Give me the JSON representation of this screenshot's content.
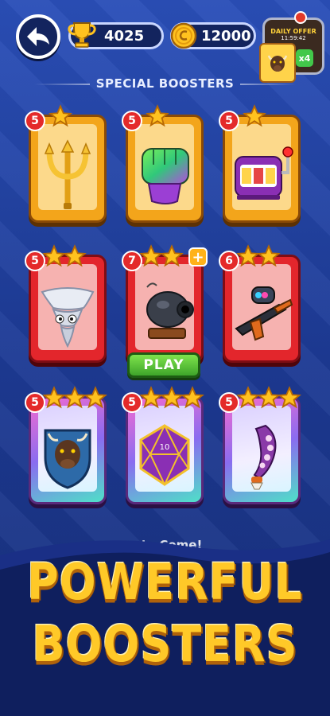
{
  "header": {
    "trophy_count": "4025",
    "coin_count": "12000",
    "daily_offer": {
      "title": "DAILY OFFER",
      "timer": "11:59:42",
      "multiplier": "x4"
    }
  },
  "section_title": "SPECIAL BOOSTERS",
  "boosters": [
    {
      "name": "trident",
      "level": "5",
      "stars": 1,
      "rarity": "gold"
    },
    {
      "name": "fist",
      "level": "5",
      "stars": 1,
      "rarity": "gold"
    },
    {
      "name": "slot-machine",
      "level": "5",
      "stars": 1,
      "rarity": "gold"
    },
    {
      "name": "tornado",
      "level": "5",
      "stars": 2,
      "rarity": "red"
    },
    {
      "name": "cannon",
      "level": "7",
      "stars": 2,
      "rarity": "red",
      "upgradeable": true,
      "action": "PLAY"
    },
    {
      "name": "paintball-gun",
      "level": "6",
      "stars": 2,
      "rarity": "red"
    },
    {
      "name": "bison-shield",
      "level": "5",
      "stars": 3,
      "rarity": "holo"
    },
    {
      "name": "d20-dice",
      "level": "5",
      "stars": 3,
      "rarity": "holo",
      "dice_face": "10"
    },
    {
      "name": "tentacle",
      "level": "5",
      "stars": 3,
      "rarity": "holo"
    }
  ],
  "footer_partial_text": "...te Come!",
  "headline": {
    "line1": "POWERFUL",
    "line2": "BOOSTERS"
  },
  "colors": {
    "background": "#1f3c9a",
    "headline": "#ffc928",
    "play": "#3ea42a"
  }
}
